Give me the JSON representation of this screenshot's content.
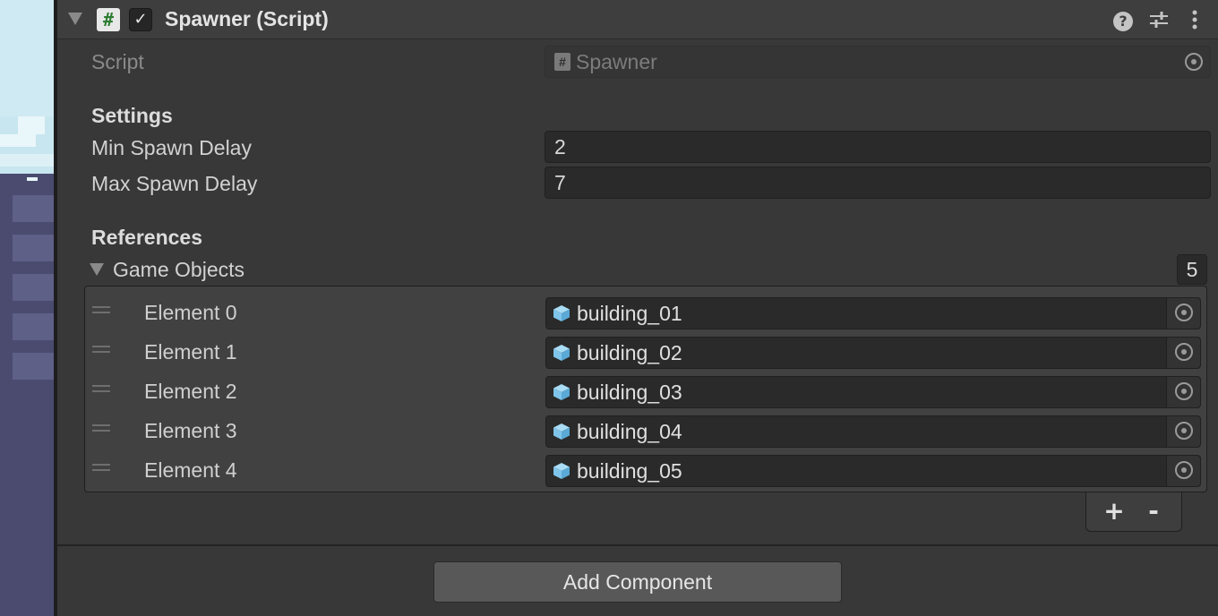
{
  "component": {
    "title": "Spawner (Script)",
    "enabled": true,
    "icons": [
      "help-icon",
      "presets-icon",
      "kebab-menu-icon"
    ]
  },
  "script_field": {
    "label": "Script",
    "value": "Spawner"
  },
  "settings": {
    "header": "Settings",
    "min_spawn_delay": {
      "label": "Min Spawn Delay",
      "value": "2"
    },
    "max_spawn_delay": {
      "label": "Max Spawn Delay",
      "value": "7"
    }
  },
  "references": {
    "header": "References",
    "list_label": "Game Objects",
    "count": "5",
    "elements": [
      {
        "label": "Element 0",
        "value": "building_01"
      },
      {
        "label": "Element 1",
        "value": "building_02"
      },
      {
        "label": "Element 2",
        "value": "building_03"
      },
      {
        "label": "Element 3",
        "value": "building_04"
      },
      {
        "label": "Element 4",
        "value": "building_05"
      }
    ],
    "add_symbol": "+",
    "remove_symbol": "-"
  },
  "add_component_label": "Add Component",
  "colors": {
    "background": "#383838",
    "field": "#2a2a2a",
    "cube_icon": "#7fc4ea",
    "script_icon_hash": "#2e7d32"
  }
}
